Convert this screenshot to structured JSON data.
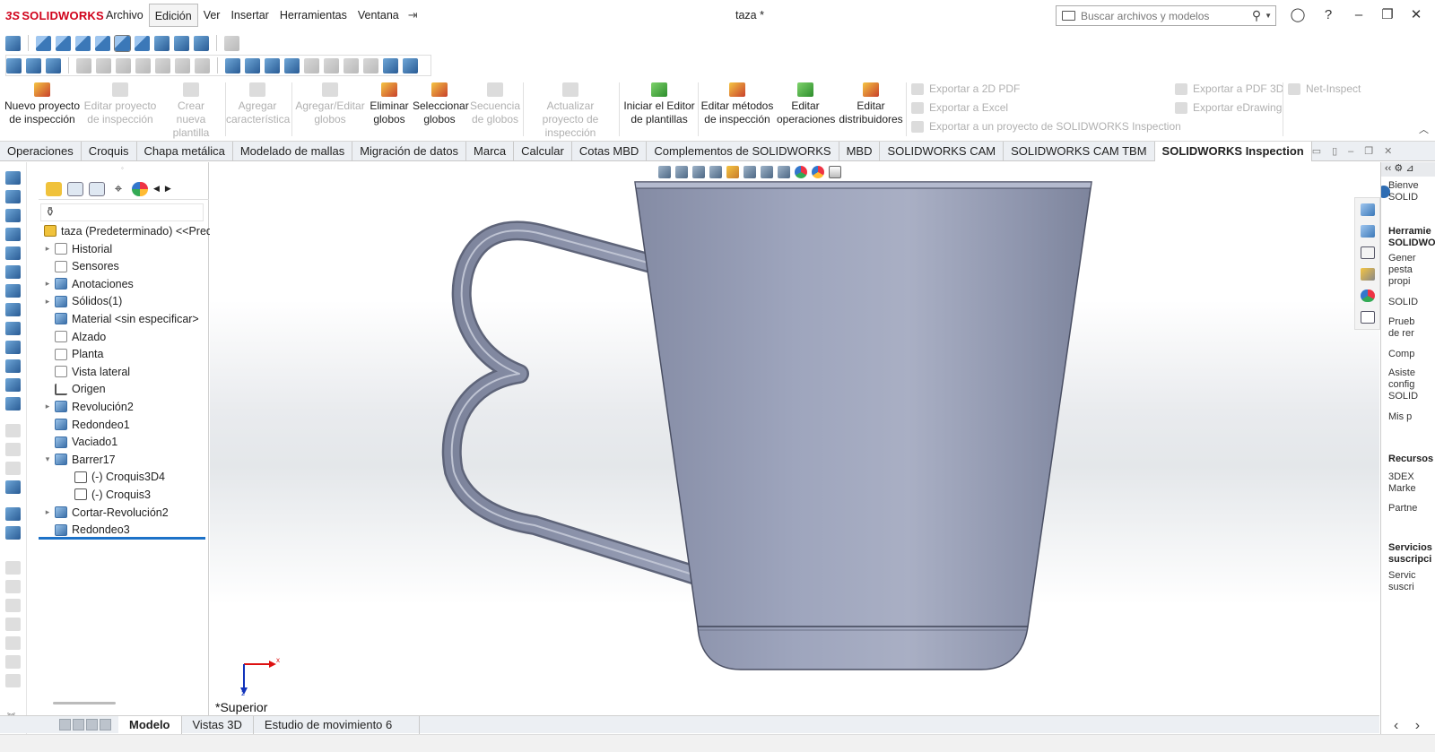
{
  "app": {
    "logo_text": "SOLIDWORKS",
    "logo_prefix": "3S",
    "doc_title": "taza *"
  },
  "menu": {
    "items": [
      "Archivo",
      "Edición",
      "Ver",
      "Insertar",
      "Herramientas",
      "Ventana"
    ],
    "active": "Edición"
  },
  "search": {
    "placeholder": "Buscar archivos y modelos"
  },
  "ribbon": {
    "buttons": [
      {
        "label": "Nuevo proyecto de inspección",
        "enabled": true
      },
      {
        "label": "Editar proyecto de inspección",
        "enabled": false
      },
      {
        "label": "Crear nueva plantilla",
        "enabled": false
      },
      {
        "label": "Agregar característica",
        "enabled": false
      },
      {
        "label": "Agregar/Editar globos",
        "enabled": false
      },
      {
        "label": "Eliminar globos",
        "enabled": true
      },
      {
        "label": "Seleccionar globos",
        "enabled": true
      },
      {
        "label": "Secuencia de globos",
        "enabled": false
      },
      {
        "label": "Actualizar proyecto de inspección",
        "enabled": false
      },
      {
        "label": "Iniciar el Editor de plantillas",
        "enabled": true
      },
      {
        "label": "Editar métodos de inspección",
        "enabled": true
      },
      {
        "label": "Editar operaciones",
        "enabled": true
      },
      {
        "label": "Editar distribuidores",
        "enabled": true
      }
    ],
    "exports": {
      "pdf2d": "Exportar a 2D PDF",
      "excel": "Exportar a Excel",
      "inspection_project": "Exportar a un proyecto de SOLIDWORKS Inspection",
      "pdf3d": "Exportar a PDF 3D",
      "edrawing": "Exportar eDrawing",
      "net_inspect": "Net-Inspect"
    }
  },
  "tabs": {
    "items": [
      "Operaciones",
      "Croquis",
      "Chapa metálica",
      "Modelado de mallas",
      "Migración de datos",
      "Marca",
      "Calcular",
      "Cotas MBD",
      "Complementos de SOLIDWORKS",
      "MBD",
      "SOLIDWORKS CAM",
      "SOLIDWORKS CAM TBM",
      "SOLIDWORKS Inspection"
    ],
    "active": "SOLIDWORKS Inspection"
  },
  "tree": {
    "root": "taza (Predeterminado) <<Pred",
    "items": [
      {
        "label": "Historial",
        "icon": "history-icon",
        "expandable": true
      },
      {
        "label": "Sensores",
        "icon": "sensor-icon",
        "expandable": false
      },
      {
        "label": "Anotaciones",
        "icon": "annotation-icon",
        "expandable": true
      },
      {
        "label": "Sólidos(1)",
        "icon": "solid-bodies-icon",
        "expandable": true
      },
      {
        "label": "Material <sin especificar>",
        "icon": "material-icon",
        "expandable": false
      },
      {
        "label": "Alzado",
        "icon": "plane-icon",
        "expandable": false
      },
      {
        "label": "Planta",
        "icon": "plane-icon",
        "expandable": false
      },
      {
        "label": "Vista lateral",
        "icon": "plane-icon",
        "expandable": false
      },
      {
        "label": "Origen",
        "icon": "origin-icon",
        "expandable": false
      },
      {
        "label": "Revolución2",
        "icon": "revolve-icon",
        "expandable": true
      },
      {
        "label": "Redondeo1",
        "icon": "fillet-icon",
        "expandable": false
      },
      {
        "label": "Vaciado1",
        "icon": "shell-icon",
        "expandable": false
      },
      {
        "label": "Barrer17",
        "icon": "sweep-icon",
        "expandable": true,
        "expanded": true
      },
      {
        "label": "(-) Croquis3D4",
        "icon": "sketch3d-icon",
        "child": true
      },
      {
        "label": "(-) Croquis3",
        "icon": "sketch-icon",
        "child": true
      },
      {
        "label": "Cortar-Revolución2",
        "icon": "cut-revolve-icon",
        "expandable": true
      },
      {
        "label": "Redondeo3",
        "icon": "fillet-icon",
        "expandable": false
      }
    ]
  },
  "viewport": {
    "view_name": "*Superior",
    "triad_x": "x",
    "triad_z": "z"
  },
  "bottom_tabs": {
    "items": [
      "Modelo",
      "Vistas 3D",
      "Estudio de movimiento 6"
    ],
    "active": "Modelo"
  },
  "task_pane": {
    "welcome": "Bienve SOLID",
    "tools_header": "Herramie SOLIDWO",
    "items": [
      "Gener pesta propi",
      "SOLID",
      "Prueb de rer",
      "Comp",
      "Asiste config SOLID",
      "Mis p"
    ],
    "resources_header": "Recursos",
    "resources": [
      "3DEX Marke",
      "Partne"
    ],
    "services_header": "Servicios suscripci",
    "services": [
      "Servic suscri"
    ]
  },
  "colors": {
    "accent": "#1d72c8",
    "brand": "#d0021b",
    "model": "#8e96ad"
  }
}
